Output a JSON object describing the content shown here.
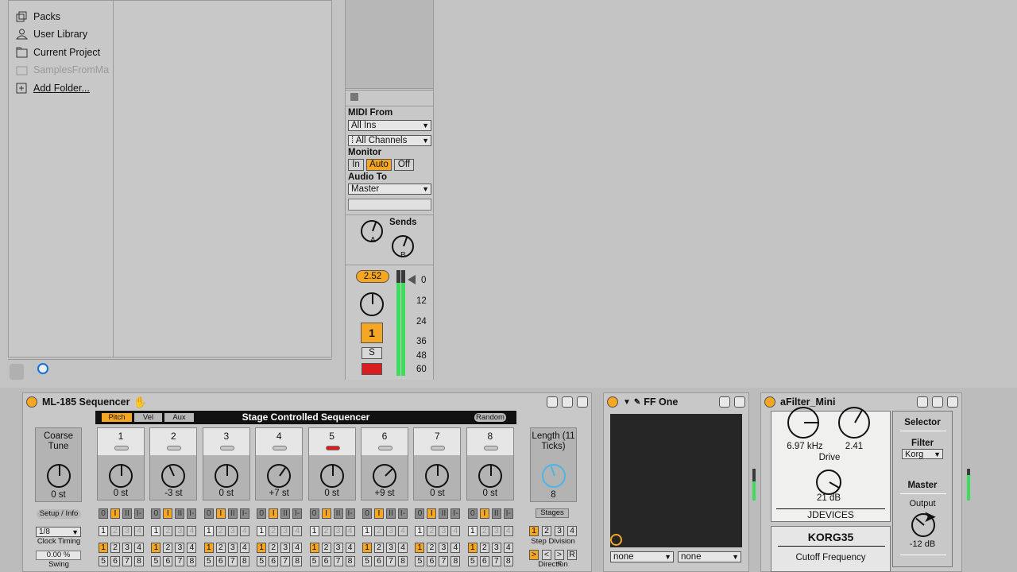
{
  "browser": {
    "places": [
      {
        "label": "Packs",
        "icon": "packs-icon"
      },
      {
        "label": "User Library",
        "icon": "user-icon"
      },
      {
        "label": "Current Project",
        "icon": "folder-icon"
      },
      {
        "label": "SamplesFromMa",
        "icon": "folder-icon"
      },
      {
        "label": "Add Folder...",
        "icon": "add-folder-icon"
      }
    ]
  },
  "track": {
    "midi_from_label": "MIDI From",
    "midi_from_value": "All Ins",
    "channel_value": "⁞ All Channels",
    "monitor_label": "Monitor",
    "monitor_in": "In",
    "monitor_auto": "Auto",
    "monitor_off": "Off",
    "audio_to_label": "Audio To",
    "audio_to_value": "Master",
    "sends_label": "Sends",
    "send_a": "A",
    "send_b": "B",
    "volume": "2.52",
    "track_number": "1",
    "solo": "S",
    "meter_ticks": [
      "0",
      "12",
      "24",
      "36",
      "48",
      "60"
    ],
    "meter_level": 0.88
  },
  "sequencer": {
    "title": "ML-185 Sequencer",
    "header": "Stage Controlled Sequencer",
    "tabs": [
      "Pitch",
      "Vel",
      "Aux"
    ],
    "random": "Random",
    "coarse_label": "Coarse Tune",
    "coarse_value": "0 st",
    "setup": "Setup / Info",
    "clock_value": "1/8",
    "clock_label": "Clock Timing",
    "swing_value": "0.00 %",
    "swing_label": "Swing",
    "length_label": "Length (11 Ticks)",
    "length_value": "8",
    "stages_label": "Stages",
    "stages": [
      "1",
      "2",
      "3",
      "4"
    ],
    "step_division": "Step Division",
    "direction": "Direction",
    "dir_buttons": [
      ">",
      "<",
      "><",
      "R"
    ],
    "gate_labels": [
      "0",
      "I",
      "II",
      "I-"
    ],
    "steps": [
      {
        "num": "1",
        "value": "0 st",
        "active_stage": 0,
        "red": false
      },
      {
        "num": "2",
        "value": "-3 st",
        "active_stage": 0,
        "red": false
      },
      {
        "num": "3",
        "value": "0 st",
        "active_stage": 0,
        "red": false
      },
      {
        "num": "4",
        "value": "+7 st",
        "active_stage": 0,
        "red": false
      },
      {
        "num": "5",
        "value": "0 st",
        "active_stage": 0,
        "red": true
      },
      {
        "num": "6",
        "value": "+9 st",
        "active_stage": 0,
        "red": false
      },
      {
        "num": "7",
        "value": "0 st",
        "active_stage": 0,
        "red": false
      },
      {
        "num": "8",
        "value": "0 st",
        "active_stage": 0,
        "red": false
      }
    ]
  },
  "ffone": {
    "title": "FF One",
    "sel1": "none",
    "sel2": "none"
  },
  "afilter": {
    "title": "aFilter_Mini",
    "freq": "6.97 kHz",
    "res": "2.41",
    "drive_label": "Drive",
    "drive_value": "21 dB",
    "brand": "JDEVICES",
    "model": "KORG35",
    "cutoff_label": "Cutoff Frequency",
    "selector_label": "Selector",
    "filter_label": "Filter",
    "filter_value": "Korg",
    "master_label": "Master",
    "output_label": "Output",
    "output_value": "-12 dB"
  }
}
